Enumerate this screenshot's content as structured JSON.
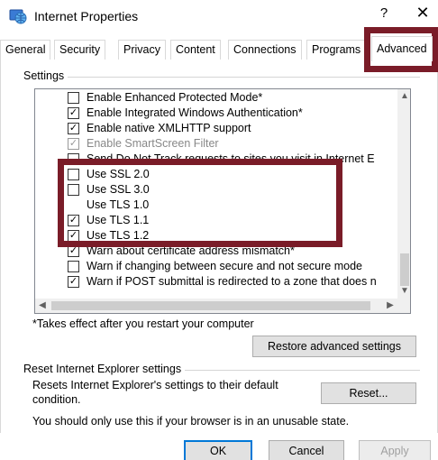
{
  "window": {
    "title": "Internet Properties",
    "help_label": "?",
    "close_label": "✕"
  },
  "tabs": [
    {
      "label": "General"
    },
    {
      "label": "Security"
    },
    {
      "label": "Privacy"
    },
    {
      "label": "Content"
    },
    {
      "label": "Connections"
    },
    {
      "label": "Programs"
    },
    {
      "label": "Advanced",
      "selected": true
    }
  ],
  "settings": {
    "group_label": "Settings",
    "items": [
      {
        "label": "Enable Enhanced Protected Mode*",
        "checked": false
      },
      {
        "label": "Enable Integrated Windows Authentication*",
        "checked": true
      },
      {
        "label": "Enable native XMLHTTP support",
        "checked": true
      },
      {
        "label": "Enable SmartScreen Filter",
        "checked": true,
        "disabled": true
      },
      {
        "label": "Send Do Not Track requests to sites you visit in Internet E",
        "checked": false
      },
      {
        "label": "Use SSL 2.0",
        "checked": false
      },
      {
        "label": "Use SSL 3.0",
        "checked": false
      },
      {
        "label": "Use TLS 1.0",
        "checked": false,
        "no_checkbox": true
      },
      {
        "label": "Use TLS 1.1",
        "checked": true
      },
      {
        "label": "Use TLS 1.2",
        "checked": true
      },
      {
        "label": "Warn about certificate address mismatch*",
        "checked": true
      },
      {
        "label": "Warn if changing between secure and not secure mode",
        "checked": false
      },
      {
        "label": "Warn if POST submittal is redirected to a zone that does n",
        "checked": true
      }
    ],
    "note": "*Takes effect after you restart your computer",
    "restore_button": "Restore advanced settings"
  },
  "reset": {
    "group_label": "Reset Internet Explorer settings",
    "description_line1": "Resets Internet Explorer's settings to their default",
    "description_line2": "condition.",
    "reset_button": "Reset...",
    "warning": "You should only use this if your browser is in an unusable state."
  },
  "footer": {
    "ok": "OK",
    "cancel": "Cancel",
    "apply": "Apply"
  },
  "colors": {
    "highlight": "#7a1c28",
    "default_button_border": "#0078d7"
  },
  "icons": {
    "app": "internet-properties-globe-icon",
    "scroll_up": "chevron-up-icon",
    "scroll_down": "chevron-down-icon",
    "scroll_left": "chevron-left-icon",
    "scroll_right": "chevron-right-icon"
  }
}
